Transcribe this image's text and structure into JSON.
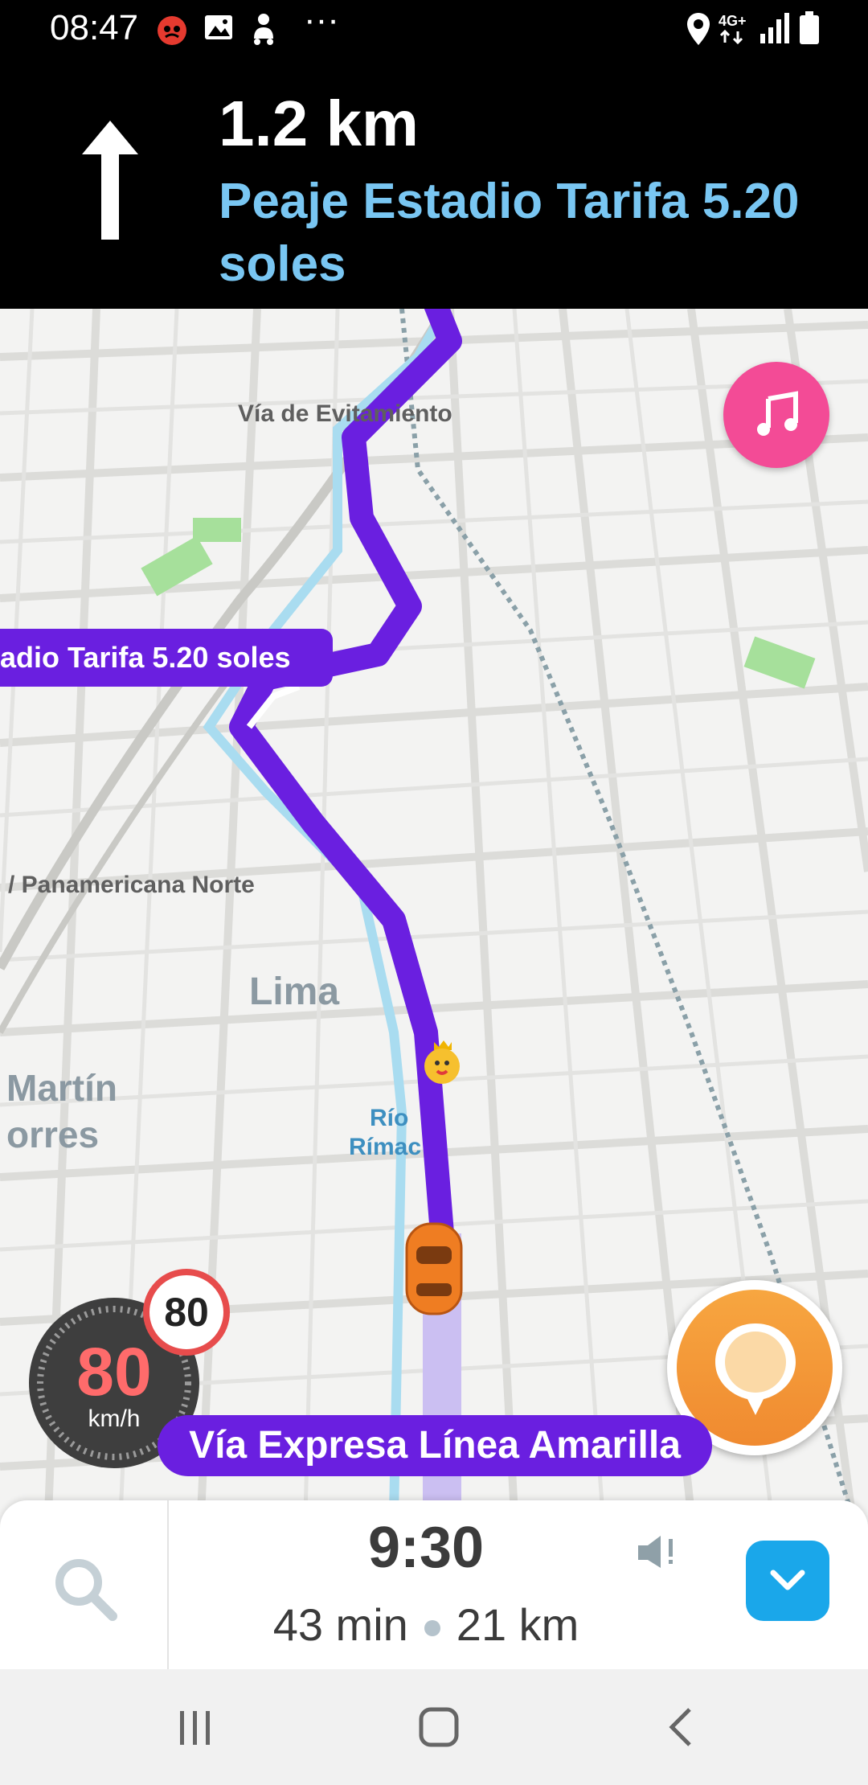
{
  "status_bar": {
    "time": "08:47",
    "more": "···",
    "network": "4G+",
    "icons": [
      "game-icon",
      "gallery-icon",
      "waze-icon",
      "more-icon",
      "location-icon",
      "4g-data-icon",
      "signal-icon",
      "battery-icon"
    ]
  },
  "nav_banner": {
    "distance": "1.2 km",
    "street": "Peaje Estadio Tarifa 5.20 soles",
    "direction_icon": "arrow-up-icon"
  },
  "map": {
    "labels": {
      "via_evitamiento": "Vía de Evitamiento",
      "panamericana": "/ Panamericana Norte",
      "lima": "Lima",
      "martin": "Martín",
      "porres": "orres",
      "rio": "Río",
      "rimac": "Rímac"
    },
    "route_callout": "adio Tarifa 5.20 soles",
    "current_street": "Vía Expresa Línea Amarilla",
    "colors": {
      "route": "#6a1fe0",
      "water": "#a9dcf0",
      "park": "#a6e09b",
      "road": "#d9d9d7"
    }
  },
  "speedometer": {
    "speed": "80",
    "unit": "km/h",
    "limit": "80"
  },
  "buttons": {
    "music_icon": "music-note-icon",
    "report_icon": "report-pin-icon"
  },
  "trip_panel": {
    "eta": "9:30",
    "duration": "43 min",
    "distance": "21 km",
    "search_icon": "search-icon",
    "sound_icon": "sound-alert-icon",
    "expand_icon": "chevron-down-icon"
  },
  "system_nav": {
    "icons": [
      "recent-apps-icon",
      "home-icon",
      "back-icon"
    ]
  }
}
